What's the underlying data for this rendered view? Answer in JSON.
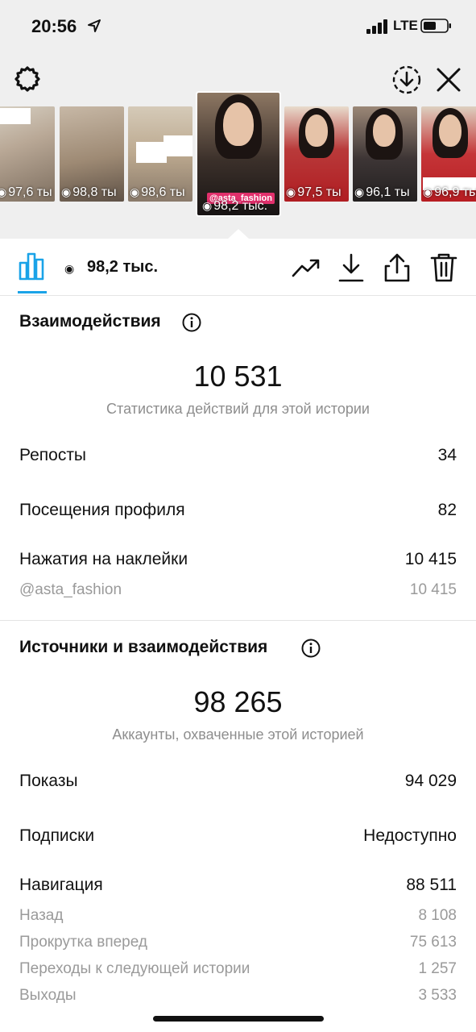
{
  "status_bar": {
    "time": "20:56",
    "network": "LTE"
  },
  "thumbnails": [
    {
      "views": "97,6 ты"
    },
    {
      "views": "98,8 ты"
    },
    {
      "views": "98,6 ты"
    },
    {
      "views": "98,2 тыс.",
      "handle": "@asta_fashion",
      "selected": true
    },
    {
      "views": "97,5 ты"
    },
    {
      "views": "96,1 ты"
    },
    {
      "views": "96,9 ты"
    }
  ],
  "action_bar": {
    "views_count": "98,2 тыс."
  },
  "interactions": {
    "title": "Взаимодействия",
    "total": "10 531",
    "caption": "Статистика действий для этой истории",
    "rows": [
      {
        "label": "Репосты",
        "value": "34"
      },
      {
        "label": "Посещения профиля",
        "value": "82"
      },
      {
        "label": "Нажатия на наклейки",
        "value": "10 415"
      }
    ],
    "sticker_sub": {
      "label": "@asta_fashion",
      "value": "10 415"
    }
  },
  "discovery": {
    "title": "Источники и взаимодействия",
    "total": "98 265",
    "caption": "Аккаунты, охваченные этой историей",
    "rows": [
      {
        "label": "Показы",
        "value": "94 029"
      },
      {
        "label": "Подписки",
        "value": "Недоступно"
      },
      {
        "label": "Навигация",
        "value": "88 511"
      }
    ],
    "navigation_sub": [
      {
        "label": "Назад",
        "value": "8 108"
      },
      {
        "label": "Прокрутка вперед",
        "value": "75 613"
      },
      {
        "label": "Переходы к следующей истории",
        "value": "1 257"
      },
      {
        "label": "Выходы",
        "value": "3 533"
      }
    ]
  },
  "colors": {
    "accent": "#1aa3e8",
    "secondary_text": "#8e8e8e"
  },
  "icons": [
    "location-arrow-icon",
    "signal-icon",
    "battery-icon",
    "gear-icon",
    "save-story-icon",
    "close-icon",
    "bar-chart-icon",
    "eye-icon",
    "trend-icon",
    "download-icon",
    "share-icon",
    "trash-icon",
    "info-icon"
  ]
}
